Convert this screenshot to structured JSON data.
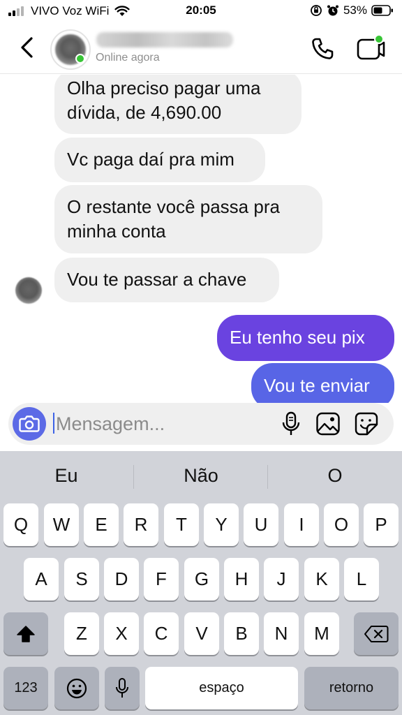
{
  "status_bar": {
    "carrier": "VIVO Voz WiFi",
    "time": "20:05",
    "battery": "53%",
    "icons": [
      "signal-icon",
      "wifi-icon",
      "orientation-lock-icon",
      "alarm-icon",
      "battery-icon"
    ]
  },
  "header": {
    "contact_status": "Online agora",
    "icons": [
      "back-chevron-icon",
      "phone-icon",
      "video-call-icon"
    ],
    "online_color": "#38c536"
  },
  "messages": [
    {
      "from": "contact",
      "text_lines": [
        "Olha preciso pagar uma",
        "dívida, de 4,690.00"
      ]
    },
    {
      "from": "contact",
      "text_lines": [
        "Vc paga daí pra mim"
      ]
    },
    {
      "from": "contact",
      "text_lines": [
        "O restante você passa pra",
        "minha conta"
      ]
    },
    {
      "from": "contact",
      "text_lines": [
        "Vou te passar a chave"
      ]
    },
    {
      "from": "me",
      "text_lines": [
        "Eu tenho seu pix"
      ]
    },
    {
      "from": "me",
      "text_lines": [
        "Vou te enviar"
      ]
    }
  ],
  "composer": {
    "placeholder": "Mensagem...",
    "icons": [
      "camera-icon",
      "microphone-icon",
      "gallery-icon",
      "sticker-icon"
    ],
    "camera_color": "#5c6ae6"
  },
  "keyboard": {
    "suggestions": [
      "Eu",
      "Não",
      "O"
    ],
    "row1": [
      "Q",
      "W",
      "E",
      "R",
      "T",
      "Y",
      "U",
      "I",
      "O",
      "P"
    ],
    "row2": [
      "A",
      "S",
      "D",
      "F",
      "G",
      "H",
      "J",
      "K",
      "L"
    ],
    "row3": [
      "Z",
      "X",
      "C",
      "V",
      "B",
      "N",
      "M"
    ],
    "numbers_label": "123",
    "space_label": "espaço",
    "return_label": "retorno",
    "icons": [
      "shift-icon",
      "backspace-icon",
      "emoji-icon",
      "dictation-icon"
    ]
  },
  "colors": {
    "incoming_bubble": "#efefef",
    "outgoing_bubble_start": "#6a3fe0",
    "outgoing_bubble_end": "#5566e6"
  }
}
